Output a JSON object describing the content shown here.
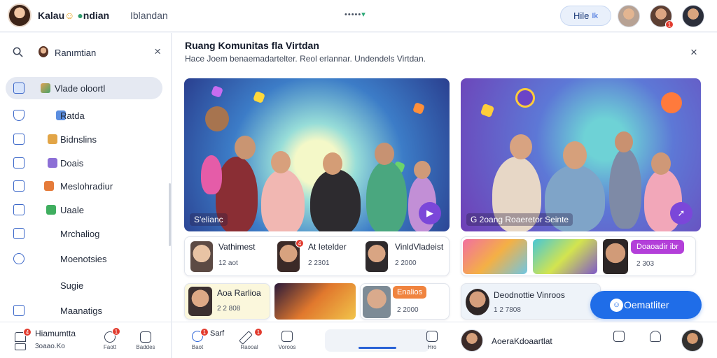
{
  "topbar": {
    "app_title_part1": "Kalau",
    "app_title_part2": "ndian",
    "center_tab": "Iblandan",
    "dots": "•••••",
    "action_button": "Hile",
    "action_button_icon": "Ik",
    "notification_badge": "1"
  },
  "sidebar": {
    "search_text": "Ranımtian",
    "items": [
      {
        "label": "Vlade oloortl",
        "icon": "dashboard-icon",
        "active": true
      },
      {
        "label": "Ratda",
        "icon": "shield-icon"
      },
      {
        "label": "Bidnslins",
        "icon": "chat-icon"
      },
      {
        "label": "Doais",
        "icon": "chart-icon"
      },
      {
        "label": "Meslohradiur",
        "icon": "check-icon"
      },
      {
        "label": "Uaale",
        "icon": "home-icon"
      },
      {
        "label": "Mrchaliog",
        "icon": "box-icon"
      },
      {
        "label": "Moenotsies",
        "icon": "search-icon"
      },
      {
        "label": "Sugie",
        "icon": ""
      },
      {
        "label": "Maanatigs",
        "icon": "home-icon"
      }
    ],
    "footer": {
      "title": "Hiamumtta",
      "subtitle": "3oaao.Ko",
      "badge": "4",
      "actions": [
        {
          "caption": "Faott",
          "badge": "1"
        },
        {
          "caption": "Baddes"
        }
      ]
    }
  },
  "main": {
    "title": "Ruang Komunitas fla Virtdan",
    "subtitle": "Hace Joem benaemadartelter. Reol erlannar. Undendels Virtdan.",
    "hero_left_caption": "S'elianc",
    "hero_right_caption": "G 2oang  Roaeretor Seinte",
    "cards": [
      {
        "name": "Vathimest",
        "meta": "12 aot"
      },
      {
        "name": "At Ietelder",
        "meta": "2 2301",
        "badge": "4"
      },
      {
        "name": "VinldVladeist",
        "meta": "2 2000"
      },
      {
        "name": "Aoa Rarlioa",
        "meta": "2 2 808"
      },
      {
        "name": "Enalios",
        "meta": "2 2000"
      },
      {
        "name": "Doaoadir ibr",
        "meta": "2 303"
      },
      {
        "name": "Deodnottie Vinroos",
        "meta": "1 2 7808"
      }
    ],
    "cta_label": "Oematliter"
  },
  "bottombar": {
    "items": [
      {
        "caption": "Baot",
        "label": "Sarf",
        "badge": "1"
      },
      {
        "caption": "Raooal",
        "badge": "1"
      },
      {
        "caption": "Voroos"
      },
      {
        "caption": "Hro"
      }
    ],
    "user_name": "AoeraKdoaartlat"
  },
  "colors": {
    "accent": "#1f6de8",
    "active_nav_bg": "#e5e9f2",
    "badge": "#e23b2e",
    "purple": "#7b47d9",
    "orange": "#f0843f"
  }
}
